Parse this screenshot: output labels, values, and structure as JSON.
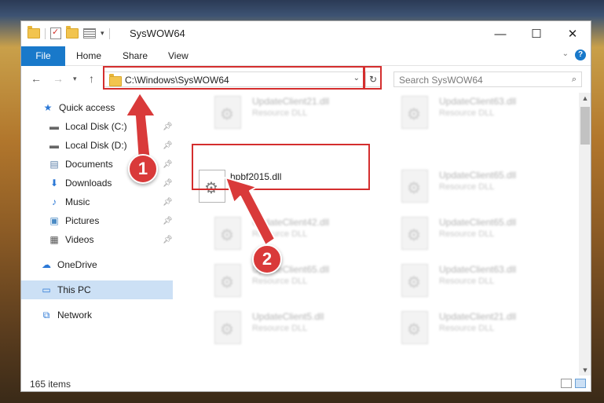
{
  "window": {
    "title": "SysWOW64",
    "minimize": "—",
    "maximize": "☐",
    "close": "✕"
  },
  "ribbon": {
    "tabs": [
      "File",
      "Home",
      "Share",
      "View"
    ],
    "help": "?"
  },
  "address": {
    "path": "C:\\Windows\\SysWOW64",
    "search_placeholder": "Search SysWOW64"
  },
  "nav": {
    "items": [
      {
        "label": "Quick access",
        "icon": "star-icon"
      },
      {
        "label": "Local Disk (C:)",
        "icon": "drive-icon",
        "pinned": true
      },
      {
        "label": "Local Disk (D:)",
        "icon": "drive-icon",
        "pinned": true
      },
      {
        "label": "Documents",
        "icon": "documents-icon",
        "pinned": true
      },
      {
        "label": "Downloads",
        "icon": "download-icon",
        "pinned": true
      },
      {
        "label": "Music",
        "icon": "music-icon",
        "pinned": true
      },
      {
        "label": "Pictures",
        "icon": "pictures-icon",
        "pinned": true
      },
      {
        "label": "Videos",
        "icon": "videos-icon",
        "pinned": true
      },
      {
        "label": "OneDrive",
        "icon": "cloud-icon"
      },
      {
        "label": "This PC",
        "icon": "computer-icon",
        "selected": true
      },
      {
        "label": "Network",
        "icon": "network-icon"
      }
    ]
  },
  "files": {
    "left": [
      {
        "name": "UpdateClient21.dll",
        "type": "Resource DLL"
      },
      {
        "name": "hpbf2015.dll",
        "type": ""
      },
      {
        "name": "UpdateClient42.dll",
        "type": "Resource DLL"
      },
      {
        "name": "UpdateClient65.dll",
        "type": "Resource DLL"
      },
      {
        "name": "UpdateClient5.dll",
        "type": "Resource DLL"
      }
    ],
    "right": [
      {
        "name": "UpdateClient63.dll",
        "type": "Resource DLL"
      },
      {
        "name": "UpdateClient65.dll",
        "type": "Resource DLL"
      },
      {
        "name": "UpdateClient65.dll",
        "type": "Resource DLL"
      },
      {
        "name": "UpdateClient63.dll",
        "type": "Resource DLL"
      },
      {
        "name": "UpdateClient21.dll",
        "type": "Resource DLL"
      }
    ]
  },
  "status": {
    "count": "165 items"
  },
  "callouts": [
    "1",
    "2"
  ],
  "colors": {
    "accent": "#1979ca",
    "annotation": "#d93a3a"
  }
}
